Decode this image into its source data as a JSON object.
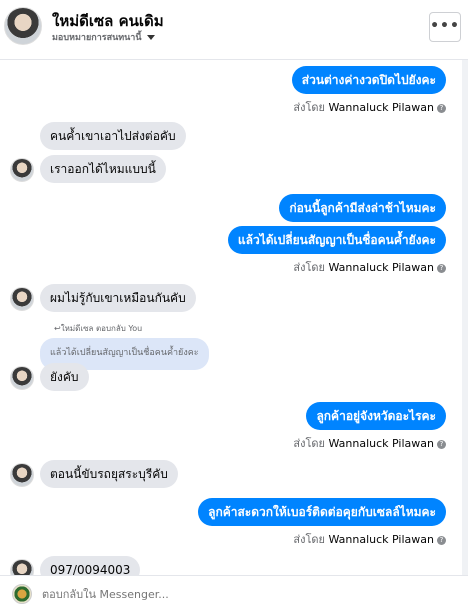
{
  "header": {
    "name": "ใหม่ดีเซล คนเดิม",
    "assign_label": "มอบหมายการสนทนานี้",
    "more_label": "•••"
  },
  "messages": [
    {
      "dir": "out",
      "text": "ส่วนต่างค่างวดปิดไปยังคะ"
    },
    {
      "dir": "meta",
      "text": "ส่งโดย",
      "sender": "Wannaluck Pilawan"
    },
    {
      "dir": "in",
      "text": "คนค้ำเขาเอาไปส่งต่อคับ"
    },
    {
      "dir": "in",
      "text": "เราออกได้ไหมแบบนี้"
    },
    {
      "dir": "out",
      "text": "ก่อนนี้ลูกค้ามีส่งล่าช้าไหมคะ"
    },
    {
      "dir": "out",
      "text": "แล้วได้เปลี่ยนสัญญาเป็นชื่อคนค้ำยังคะ"
    },
    {
      "dir": "meta",
      "text": "ส่งโดย",
      "sender": "Wannaluck Pilawan"
    },
    {
      "dir": "in",
      "text": "ผมไม่รู้กับเขาเหมือนกันคับ"
    },
    {
      "dir": "note",
      "text": "ใหม่ดีเซล ตอบกลับ You"
    },
    {
      "dir": "quote",
      "text": "แล้วได้เปลี่ยนสัญญาเป็นชื่อคนค้ำยังคะ"
    },
    {
      "dir": "in",
      "text": "ยังคับ"
    },
    {
      "dir": "out",
      "text": "ลูกค้าอยู่จังหวัดอะไรคะ"
    },
    {
      "dir": "meta",
      "text": "ส่งโดย",
      "sender": "Wannaluck Pilawan"
    },
    {
      "dir": "in",
      "text": "ตอนนี้ขับรถยุสระบุรีคับ"
    },
    {
      "dir": "out",
      "text": "ลูกค้าสะดวกให้เบอร์ติดต่อคุยกับเซลล์ไหมคะ"
    },
    {
      "dir": "meta",
      "text": "ส่งโดย",
      "sender": "Wannaluck Pilawan"
    },
    {
      "dir": "in",
      "text": "097/0094003"
    }
  ],
  "composer": {
    "placeholder": "ตอบกลับใน Messenger..."
  }
}
